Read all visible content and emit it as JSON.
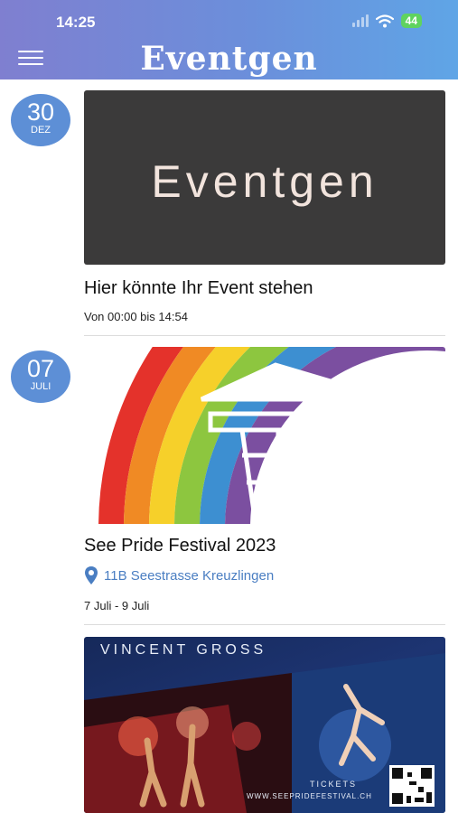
{
  "status_bar": {
    "time": "14:25",
    "battery": "44"
  },
  "header": {
    "title": "Eventgen"
  },
  "events": [
    {
      "day": "30",
      "month": "DEZ",
      "banner_text": "Eventgen",
      "title": "Hier könnte Ihr Event stehen",
      "time": "Von  00:00 bis 14:54"
    },
    {
      "day": "07",
      "month": "JULI",
      "title": "See Pride Festival 2023",
      "location": "11B Seestrasse Kreuzlingen",
      "time": "7 Juli - 9 Juli"
    },
    {
      "banner_title": "VINCENT GROSS",
      "banner_tickets": "TICKETS",
      "banner_url": "WWW.SEEPRIDEFESTIVAL.CH"
    }
  ]
}
